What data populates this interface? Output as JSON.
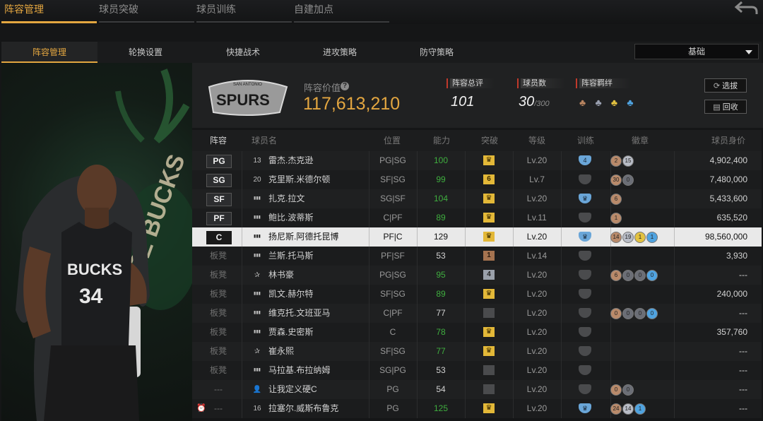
{
  "top_tabs": [
    "阵容管理",
    "球员突破",
    "球员训练",
    "自建加点"
  ],
  "sub_tabs": [
    "阵容管理",
    "轮换设置",
    "快捷战术",
    "进攻策略",
    "防守策略"
  ],
  "view_select": "基础",
  "team": {
    "logo_text": "SPURS",
    "logo_small": "SAN ANTONIO",
    "value_label": "阵容价值",
    "value": "117,613,210",
    "rating_label": "阵容总评",
    "rating": "101",
    "count_label": "球员数",
    "count": "30",
    "count_max": "/300",
    "bond_label": "阵容羁绊"
  },
  "buttons": {
    "select": "选拔",
    "recycle": "回收"
  },
  "player_card": {
    "jersey_team": "BUCKS",
    "jersey_number": "34",
    "banner_text": "EE BUCKS"
  },
  "columns": [
    "阵容",
    "球员名",
    "位置",
    "能力",
    "突破",
    "等级",
    "训练",
    "徽章",
    "球员身价"
  ],
  "colors": {
    "accent": "#e3a640",
    "green": "#3fae3f",
    "positive_val": "#3fae3f"
  },
  "rows": [
    {
      "pos": "PG",
      "icon": "13",
      "name": "雷杰.杰克逊",
      "position": "PG|SG",
      "ability": "100",
      "ability_green": true,
      "break": "crown",
      "level": "Lv.20",
      "train": "4",
      "badges": [
        [
          "2",
          "c1"
        ],
        [
          "15",
          "c3"
        ]
      ],
      "value": "4,902,400"
    },
    {
      "pos": "SG",
      "icon": "20",
      "name": "克里斯.米德尔顿",
      "position": "SF|SG",
      "ability": "99",
      "ability_green": true,
      "break": "6",
      "level": "Lv.7",
      "train": "",
      "badges": [
        [
          "30",
          "c1"
        ],
        [
          "0",
          "c2"
        ]
      ],
      "value": "7,480,000"
    },
    {
      "pos": "SF",
      "icon": "bars",
      "name": "扎克.拉文",
      "position": "SG|SF",
      "ability": "104",
      "ability_green": true,
      "break": "crown",
      "level": "Lv.20",
      "train": "b",
      "badges": [
        [
          "6",
          "c1"
        ]
      ],
      "value": "5,433,600"
    },
    {
      "pos": "PF",
      "icon": "bars",
      "name": "鲍比.波蒂斯",
      "position": "C|PF",
      "ability": "89",
      "ability_green": true,
      "break": "crown",
      "level": "Lv.11",
      "train": "",
      "badges": [
        [
          "1",
          "c1"
        ]
      ],
      "value": "635,520"
    },
    {
      "pos": "C",
      "icon": "bars",
      "name": "扬尼斯.阿德托昆博",
      "position": "PF|C",
      "ability": "129",
      "ability_green": false,
      "break": "crown",
      "level": "Lv.20",
      "train": "b",
      "badges": [
        [
          "14",
          "c1"
        ],
        [
          "19",
          "c3"
        ],
        [
          "1",
          "c4"
        ],
        [
          "1",
          "c5"
        ]
      ],
      "value": "98,560,000",
      "highlight": true
    },
    {
      "pos": "板凳",
      "icon": "bars",
      "name": "兰斯.托马斯",
      "position": "PF|SF",
      "ability": "53",
      "ability_green": false,
      "break": "1",
      "level": "Lv.14",
      "train": "",
      "badges": [],
      "value": "3,930"
    },
    {
      "pos": "板凳",
      "icon": "star",
      "name": "林书豪",
      "position": "PG|SG",
      "ability": "95",
      "ability_green": true,
      "break": "4",
      "level": "Lv.20",
      "train": "",
      "badges": [
        [
          "6",
          "c1"
        ],
        [
          "0",
          "c2"
        ],
        [
          "0",
          "c2"
        ],
        [
          "0",
          "c5"
        ]
      ],
      "value": "---"
    },
    {
      "pos": "板凳",
      "icon": "bars",
      "name": "凯文.赫尔特",
      "position": "SF|SG",
      "ability": "89",
      "ability_green": true,
      "break": "crown",
      "level": "Lv.20",
      "train": "",
      "badges": [],
      "value": "240,000"
    },
    {
      "pos": "板凳",
      "icon": "bars",
      "name": "维克托.文班亚马",
      "position": "C|PF",
      "ability": "77",
      "ability_green": false,
      "break": "none",
      "level": "Lv.20",
      "train": "",
      "badges": [
        [
          "0",
          "c1"
        ],
        [
          "0",
          "c2"
        ],
        [
          "0",
          "c2"
        ],
        [
          "0",
          "c5"
        ]
      ],
      "value": "---"
    },
    {
      "pos": "板凳",
      "icon": "bars",
      "name": "贾森.史密斯",
      "position": "C",
      "ability": "78",
      "ability_green": true,
      "break": "crown",
      "level": "Lv.20",
      "train": "",
      "badges": [],
      "value": "357,760"
    },
    {
      "pos": "板凳",
      "icon": "star",
      "name": "崔永熙",
      "position": "SF|SG",
      "ability": "77",
      "ability_green": true,
      "break": "crown",
      "level": "Lv.20",
      "train": "",
      "badges": [],
      "value": "---"
    },
    {
      "pos": "板凳",
      "icon": "bars",
      "name": "马拉基.布拉纳姆",
      "position": "SG|PG",
      "ability": "53",
      "ability_green": false,
      "break": "none",
      "level": "Lv.20",
      "train": "",
      "badges": [],
      "value": "---"
    },
    {
      "pos": "---",
      "icon": "person",
      "name": "让我定义硬C",
      "position": "PG",
      "ability": "54",
      "ability_green": false,
      "break": "none",
      "level": "Lv.20",
      "train": "",
      "badges": [
        [
          "0",
          "c1"
        ],
        [
          "0",
          "c2"
        ]
      ],
      "value": "---"
    },
    {
      "pos": "---",
      "icon": "16",
      "name": "拉塞尔.威斯布鲁克",
      "position": "PG",
      "ability": "125",
      "ability_green": true,
      "break": "crown",
      "level": "Lv.20",
      "train": "b",
      "badges": [
        [
          "24",
          "c1"
        ],
        [
          "14",
          "c3"
        ],
        [
          "1",
          "c5"
        ]
      ],
      "value": "---",
      "alarm": true
    }
  ]
}
